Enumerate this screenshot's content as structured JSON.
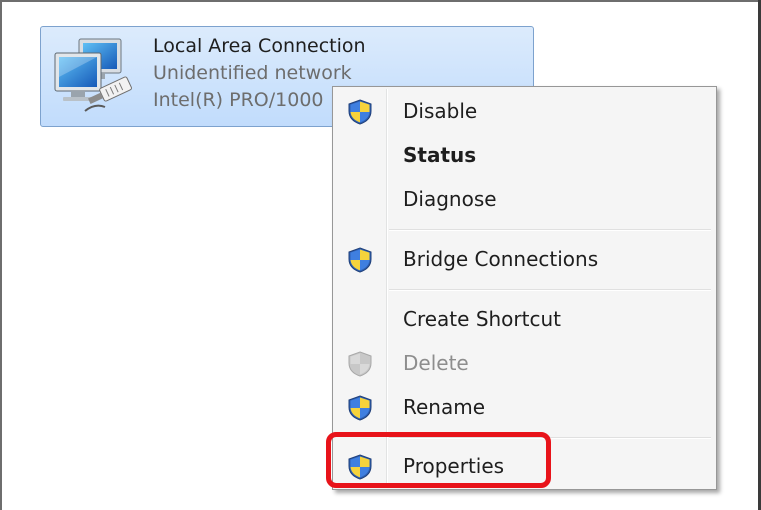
{
  "connection": {
    "name": "Local Area Connection",
    "status": "Unidentified network",
    "adapter": "Intel(R) PRO/1000"
  },
  "context_menu": {
    "items": [
      {
        "label": "Disable",
        "shield": true
      },
      {
        "label": "Status",
        "bold": true
      },
      {
        "label": "Diagnose"
      },
      {
        "label": "Bridge Connections",
        "shield": true
      },
      {
        "label": "Create Shortcut"
      },
      {
        "label": "Delete",
        "shield": true,
        "disabled": true
      },
      {
        "label": "Rename",
        "shield": true
      },
      {
        "label": "Properties",
        "shield": true,
        "highlighted": true
      }
    ]
  },
  "colors": {
    "highlight_box": "#e8131a",
    "tile_selected": "#c1dcfc"
  }
}
